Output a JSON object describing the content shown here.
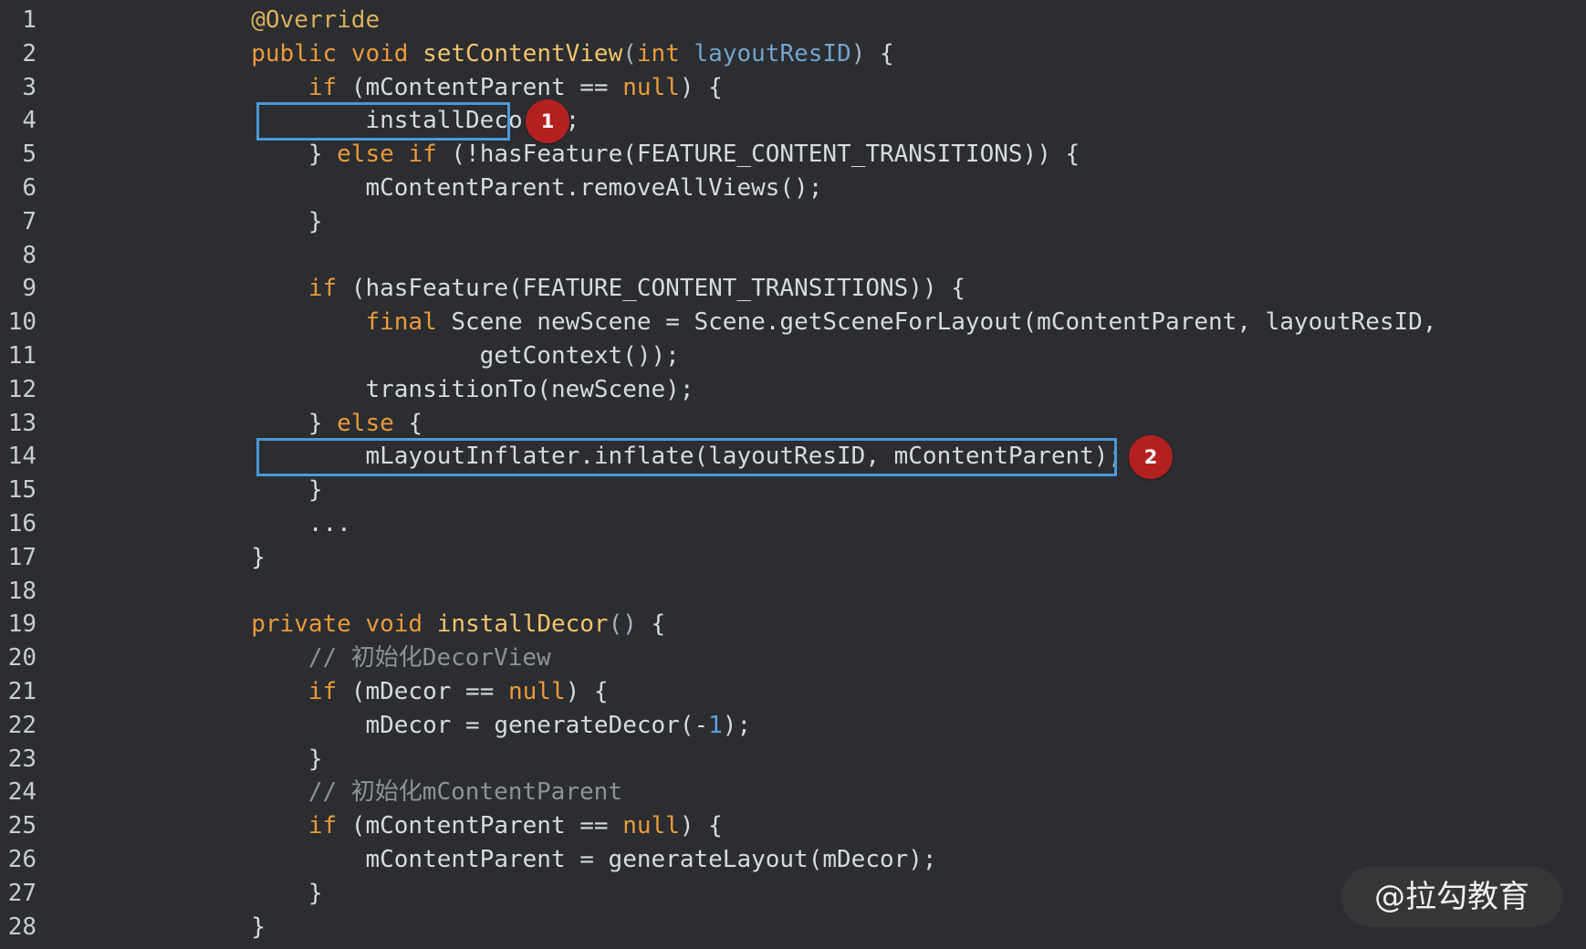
{
  "lines": [
    {
      "num": "1",
      "tokens": [
        {
          "text": "        "
        },
        {
          "text": "@Override",
          "style": "annotation"
        }
      ]
    },
    {
      "num": "2",
      "tokens": [
        {
          "text": "        "
        },
        {
          "text": "public",
          "style": "keyword"
        },
        {
          "text": " "
        },
        {
          "text": "void",
          "style": "keyword"
        },
        {
          "text": " "
        },
        {
          "text": "setContentView",
          "style": "function"
        },
        {
          "text": "(",
          "style": "bracket"
        },
        {
          "text": "int",
          "style": "keyword"
        },
        {
          "text": " "
        },
        {
          "text": "layoutResID",
          "style": "type"
        },
        {
          "text": ")",
          "style": "bracket"
        },
        {
          "text": " {"
        }
      ]
    },
    {
      "num": "3",
      "tokens": [
        {
          "text": "            "
        },
        {
          "text": "if",
          "style": "keyword"
        },
        {
          "text": " (mContentParent == "
        },
        {
          "text": "null",
          "style": "keyword"
        },
        {
          "text": ") {"
        }
      ]
    },
    {
      "num": "4",
      "tokens": [
        {
          "text": "                installDecor();"
        }
      ]
    },
    {
      "num": "5",
      "tokens": [
        {
          "text": "            } "
        },
        {
          "text": "else",
          "style": "keyword"
        },
        {
          "text": " "
        },
        {
          "text": "if",
          "style": "keyword"
        },
        {
          "text": " (!hasFeature(FEATURE_CONTENT_TRANSITIONS)) {"
        }
      ]
    },
    {
      "num": "6",
      "tokens": [
        {
          "text": "                mContentParent.removeAllViews();"
        }
      ]
    },
    {
      "num": "7",
      "tokens": [
        {
          "text": "            }"
        }
      ]
    },
    {
      "num": "8",
      "tokens": []
    },
    {
      "num": "9",
      "tokens": [
        {
          "text": "            "
        },
        {
          "text": "if",
          "style": "keyword"
        },
        {
          "text": " (hasFeature(FEATURE_CONTENT_TRANSITIONS)) {"
        }
      ]
    },
    {
      "num": "10",
      "tokens": [
        {
          "text": "                "
        },
        {
          "text": "final",
          "style": "keyword"
        },
        {
          "text": " Scene newScene = Scene.getSceneForLayout(mContentParent, layoutResID,"
        }
      ]
    },
    {
      "num": "11",
      "tokens": [
        {
          "text": "                        getContext());"
        }
      ]
    },
    {
      "num": "12",
      "tokens": [
        {
          "text": "                transitionTo(newScene);"
        }
      ]
    },
    {
      "num": "13",
      "tokens": [
        {
          "text": "            } "
        },
        {
          "text": "else",
          "style": "keyword"
        },
        {
          "text": " {"
        }
      ]
    },
    {
      "num": "14",
      "tokens": [
        {
          "text": "                mLayoutInflater.inflate(layoutResID, mContentParent);"
        }
      ]
    },
    {
      "num": "15",
      "tokens": [
        {
          "text": "            }"
        }
      ]
    },
    {
      "num": "16",
      "tokens": [
        {
          "text": "            ..."
        }
      ]
    },
    {
      "num": "17",
      "tokens": [
        {
          "text": "        }"
        }
      ]
    },
    {
      "num": "18",
      "tokens": []
    },
    {
      "num": "19",
      "tokens": [
        {
          "text": "        "
        },
        {
          "text": "private",
          "style": "keyword"
        },
        {
          "text": " "
        },
        {
          "text": "void",
          "style": "keyword"
        },
        {
          "text": " "
        },
        {
          "text": "installDecor",
          "style": "function"
        },
        {
          "text": "()",
          "style": "bracket"
        },
        {
          "text": " {"
        }
      ]
    },
    {
      "num": "20",
      "tokens": [
        {
          "text": "            "
        },
        {
          "text": "// 初始化DecorView",
          "style": "comment"
        }
      ]
    },
    {
      "num": "21",
      "tokens": [
        {
          "text": "            "
        },
        {
          "text": "if",
          "style": "keyword"
        },
        {
          "text": " (mDecor == "
        },
        {
          "text": "null",
          "style": "keyword"
        },
        {
          "text": ") {"
        }
      ]
    },
    {
      "num": "22",
      "tokens": [
        {
          "text": "                mDecor = generateDecor(-"
        },
        {
          "text": "1",
          "style": "number"
        },
        {
          "text": ");"
        }
      ]
    },
    {
      "num": "23",
      "tokens": [
        {
          "text": "            }"
        }
      ]
    },
    {
      "num": "24",
      "tokens": [
        {
          "text": "            "
        },
        {
          "text": "// 初始化mContentParent",
          "style": "comment"
        }
      ]
    },
    {
      "num": "25",
      "tokens": [
        {
          "text": "            "
        },
        {
          "text": "if",
          "style": "keyword"
        },
        {
          "text": " (mContentParent == "
        },
        {
          "text": "null",
          "style": "keyword"
        },
        {
          "text": ") {"
        }
      ]
    },
    {
      "num": "26",
      "tokens": [
        {
          "text": "                mContentParent = generateLayout(mDecor);"
        }
      ]
    },
    {
      "num": "27",
      "tokens": [
        {
          "text": "            }"
        }
      ]
    },
    {
      "num": "28",
      "tokens": [
        {
          "text": "        }"
        }
      ]
    }
  ],
  "markers": [
    "1",
    "2"
  ],
  "watermark": "@拉勾教育",
  "colors": {
    "background": "#2b2d30",
    "keyword": "#e99a3c",
    "function": "#f2c46d",
    "type": "#73a4ce",
    "comment": "#8e9296",
    "highlight_box": "#4c98d8",
    "marker": "#b42020"
  }
}
